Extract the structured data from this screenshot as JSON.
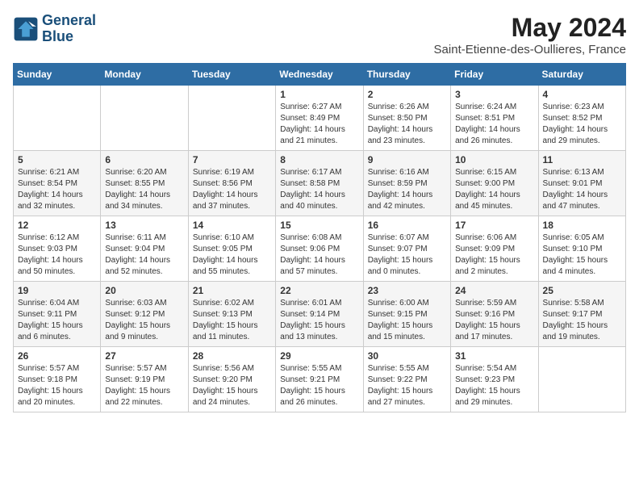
{
  "logo": {
    "line1": "General",
    "line2": "Blue"
  },
  "title": "May 2024",
  "location": "Saint-Etienne-des-Oullieres, France",
  "days_of_week": [
    "Sunday",
    "Monday",
    "Tuesday",
    "Wednesday",
    "Thursday",
    "Friday",
    "Saturday"
  ],
  "weeks": [
    [
      {
        "day": "",
        "info": ""
      },
      {
        "day": "",
        "info": ""
      },
      {
        "day": "",
        "info": ""
      },
      {
        "day": "1",
        "info": "Sunrise: 6:27 AM\nSunset: 8:49 PM\nDaylight: 14 hours\nand 21 minutes."
      },
      {
        "day": "2",
        "info": "Sunrise: 6:26 AM\nSunset: 8:50 PM\nDaylight: 14 hours\nand 23 minutes."
      },
      {
        "day": "3",
        "info": "Sunrise: 6:24 AM\nSunset: 8:51 PM\nDaylight: 14 hours\nand 26 minutes."
      },
      {
        "day": "4",
        "info": "Sunrise: 6:23 AM\nSunset: 8:52 PM\nDaylight: 14 hours\nand 29 minutes."
      }
    ],
    [
      {
        "day": "5",
        "info": "Sunrise: 6:21 AM\nSunset: 8:54 PM\nDaylight: 14 hours\nand 32 minutes."
      },
      {
        "day": "6",
        "info": "Sunrise: 6:20 AM\nSunset: 8:55 PM\nDaylight: 14 hours\nand 34 minutes."
      },
      {
        "day": "7",
        "info": "Sunrise: 6:19 AM\nSunset: 8:56 PM\nDaylight: 14 hours\nand 37 minutes."
      },
      {
        "day": "8",
        "info": "Sunrise: 6:17 AM\nSunset: 8:58 PM\nDaylight: 14 hours\nand 40 minutes."
      },
      {
        "day": "9",
        "info": "Sunrise: 6:16 AM\nSunset: 8:59 PM\nDaylight: 14 hours\nand 42 minutes."
      },
      {
        "day": "10",
        "info": "Sunrise: 6:15 AM\nSunset: 9:00 PM\nDaylight: 14 hours\nand 45 minutes."
      },
      {
        "day": "11",
        "info": "Sunrise: 6:13 AM\nSunset: 9:01 PM\nDaylight: 14 hours\nand 47 minutes."
      }
    ],
    [
      {
        "day": "12",
        "info": "Sunrise: 6:12 AM\nSunset: 9:03 PM\nDaylight: 14 hours\nand 50 minutes."
      },
      {
        "day": "13",
        "info": "Sunrise: 6:11 AM\nSunset: 9:04 PM\nDaylight: 14 hours\nand 52 minutes."
      },
      {
        "day": "14",
        "info": "Sunrise: 6:10 AM\nSunset: 9:05 PM\nDaylight: 14 hours\nand 55 minutes."
      },
      {
        "day": "15",
        "info": "Sunrise: 6:08 AM\nSunset: 9:06 PM\nDaylight: 14 hours\nand 57 minutes."
      },
      {
        "day": "16",
        "info": "Sunrise: 6:07 AM\nSunset: 9:07 PM\nDaylight: 15 hours\nand 0 minutes."
      },
      {
        "day": "17",
        "info": "Sunrise: 6:06 AM\nSunset: 9:09 PM\nDaylight: 15 hours\nand 2 minutes."
      },
      {
        "day": "18",
        "info": "Sunrise: 6:05 AM\nSunset: 9:10 PM\nDaylight: 15 hours\nand 4 minutes."
      }
    ],
    [
      {
        "day": "19",
        "info": "Sunrise: 6:04 AM\nSunset: 9:11 PM\nDaylight: 15 hours\nand 6 minutes."
      },
      {
        "day": "20",
        "info": "Sunrise: 6:03 AM\nSunset: 9:12 PM\nDaylight: 15 hours\nand 9 minutes."
      },
      {
        "day": "21",
        "info": "Sunrise: 6:02 AM\nSunset: 9:13 PM\nDaylight: 15 hours\nand 11 minutes."
      },
      {
        "day": "22",
        "info": "Sunrise: 6:01 AM\nSunset: 9:14 PM\nDaylight: 15 hours\nand 13 minutes."
      },
      {
        "day": "23",
        "info": "Sunrise: 6:00 AM\nSunset: 9:15 PM\nDaylight: 15 hours\nand 15 minutes."
      },
      {
        "day": "24",
        "info": "Sunrise: 5:59 AM\nSunset: 9:16 PM\nDaylight: 15 hours\nand 17 minutes."
      },
      {
        "day": "25",
        "info": "Sunrise: 5:58 AM\nSunset: 9:17 PM\nDaylight: 15 hours\nand 19 minutes."
      }
    ],
    [
      {
        "day": "26",
        "info": "Sunrise: 5:57 AM\nSunset: 9:18 PM\nDaylight: 15 hours\nand 20 minutes."
      },
      {
        "day": "27",
        "info": "Sunrise: 5:57 AM\nSunset: 9:19 PM\nDaylight: 15 hours\nand 22 minutes."
      },
      {
        "day": "28",
        "info": "Sunrise: 5:56 AM\nSunset: 9:20 PM\nDaylight: 15 hours\nand 24 minutes."
      },
      {
        "day": "29",
        "info": "Sunrise: 5:55 AM\nSunset: 9:21 PM\nDaylight: 15 hours\nand 26 minutes."
      },
      {
        "day": "30",
        "info": "Sunrise: 5:55 AM\nSunset: 9:22 PM\nDaylight: 15 hours\nand 27 minutes."
      },
      {
        "day": "31",
        "info": "Sunrise: 5:54 AM\nSunset: 9:23 PM\nDaylight: 15 hours\nand 29 minutes."
      },
      {
        "day": "",
        "info": ""
      }
    ]
  ]
}
